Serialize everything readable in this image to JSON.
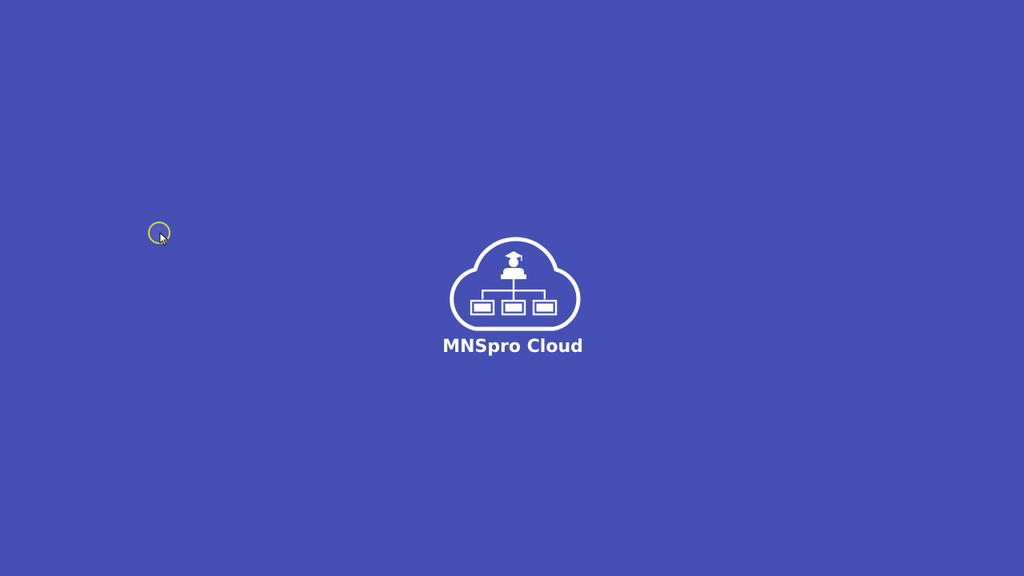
{
  "splash": {
    "app_name": "MNSpro Cloud",
    "logo_icon": "cloud-org-chart-graduate-icon",
    "background_color": "#4550b5",
    "foreground_color": "#ffffff"
  },
  "cursor": {
    "icon": "mouse-pointer-icon",
    "highlight_color": "#d9d840"
  }
}
